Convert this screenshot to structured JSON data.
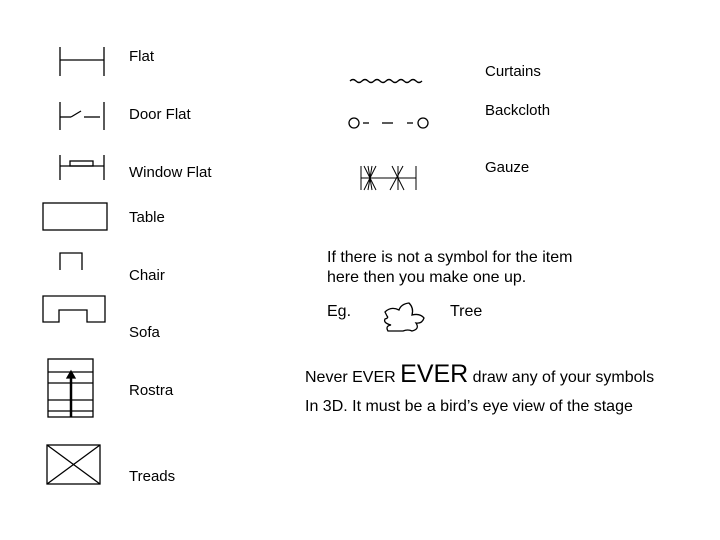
{
  "symbols_left": [
    {
      "label": "Flat",
      "icon": "flat-symbol"
    },
    {
      "label": "Door Flat",
      "icon": "door-flat-symbol"
    },
    {
      "label": "Window Flat",
      "icon": "window-flat-symbol"
    },
    {
      "label": "Table",
      "icon": "table-symbol"
    },
    {
      "label": "Chair",
      "icon": "chair-symbol"
    },
    {
      "label": "Sofa",
      "icon": "sofa-symbol"
    },
    {
      "label": "Rostra",
      "icon": "rostra-symbol"
    },
    {
      "label": "Treads",
      "icon": "treads-symbol"
    }
  ],
  "symbols_right": [
    {
      "label": "Curtains",
      "icon": "curtains-symbol"
    },
    {
      "label": "Backcloth",
      "icon": "backcloth-symbol"
    },
    {
      "label": "Gauze",
      "icon": "gauze-symbol"
    }
  ],
  "note": {
    "line1": "If there is not a symbol for the item",
    "line2": "here then you make one up.",
    "example_prefix": "Eg.",
    "example_label": "Tree"
  },
  "warning": {
    "part1": "Never EVER ",
    "emphasis": "EVER",
    "part2": " draw any of your symbols",
    "line2": "In 3D. It must be a bird’s eye view of the stage"
  }
}
